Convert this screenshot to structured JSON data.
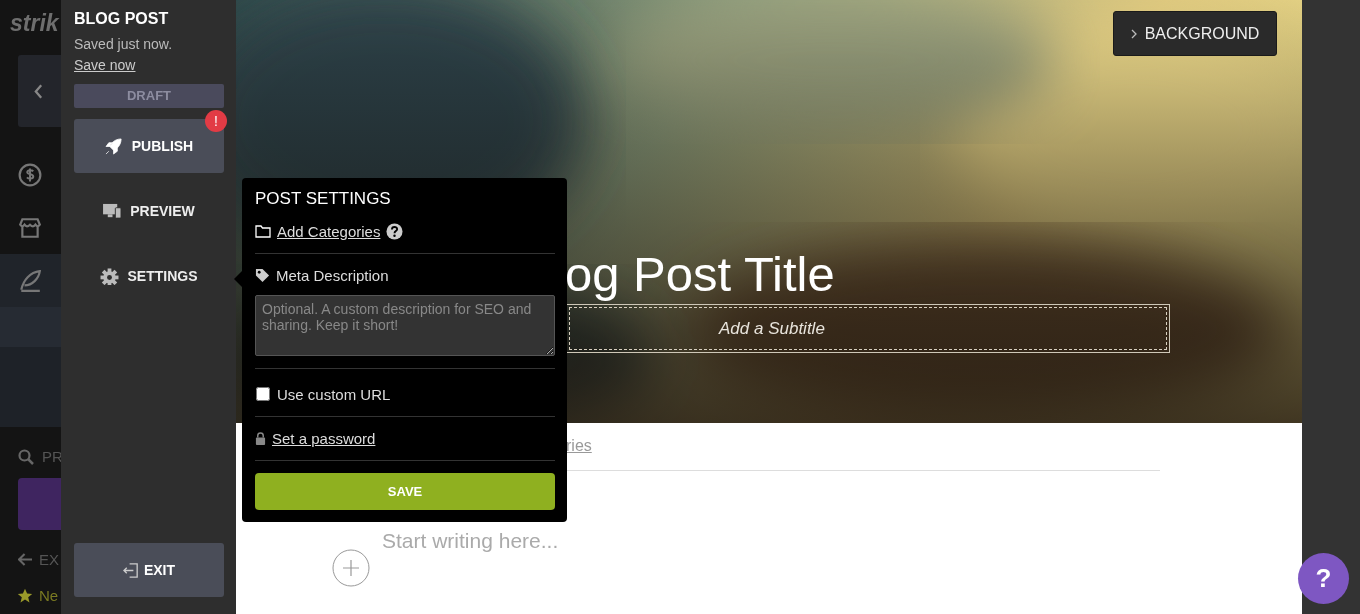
{
  "app_sidebar": {
    "logo": "strik",
    "items": [
      {
        "selected": false
      },
      {
        "selected": false
      },
      {
        "selected": true
      }
    ],
    "search": "PR",
    "exit": "EX",
    "next": "Ne"
  },
  "editor_panel": {
    "title": "BLOG POST",
    "status": "Saved just now.",
    "save_link": "Save now",
    "state_badge": "DRAFT",
    "actions": [
      {
        "kind": "primary",
        "label": "PUBLISH",
        "alert": "!"
      },
      {
        "kind": "plain",
        "label": "PREVIEW"
      },
      {
        "kind": "plain",
        "label": "SETTINGS"
      }
    ],
    "exit": "EXIT"
  },
  "settings_popup": {
    "title": "POST SETTINGS",
    "categories_link": "Add Categories",
    "meta_label": "Meta Description",
    "meta_placeholder": "Optional. A custom description for SEO and sharing. Keep it short!",
    "custom_url": {
      "label": "Use custom URL",
      "checked": false
    },
    "password_link": "Set a password",
    "save": "SAVE"
  },
  "hero": {
    "background_button": "BACKGROUND",
    "title": "og Post Title",
    "subtitle_placeholder": "Add a Subtitle"
  },
  "body": {
    "categories_link": "ries",
    "placeholder": "Start writing here..."
  },
  "help_button": "?"
}
